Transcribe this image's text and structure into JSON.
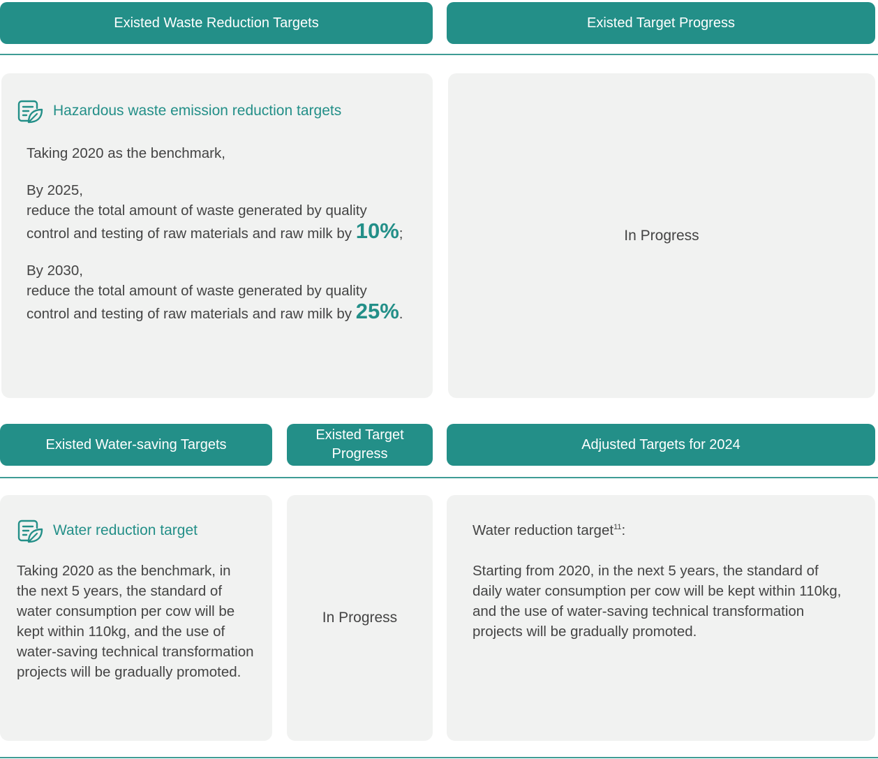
{
  "top": {
    "headers": {
      "left": "Existed Waste Reduction Targets",
      "right": "Existed Target Progress"
    },
    "hazard_card": {
      "title": "Hazardous waste emission reduction targets",
      "benchmark": "Taking 2020 as the benchmark,",
      "items": [
        {
          "year": "By 2025,",
          "text": "reduce the total amount of waste generated by quality control and testing of raw materials and raw milk by",
          "pct": "10%",
          "end": ";"
        },
        {
          "year": "By 2030,",
          "text": "reduce the total amount of waste generated by quality control and testing of raw materials and raw milk by",
          "pct": "25%",
          "end": "."
        }
      ]
    },
    "progress": "In Progress"
  },
  "bottom": {
    "headers": {
      "left": "Existed Water-saving Targets",
      "middle": "Existed Target Progress",
      "right": "Adjusted Targets for 2024"
    },
    "water_card": {
      "title": "Water reduction target",
      "text": "Taking 2020 as the benchmark, in the next 5 years, the standard of water consumption per cow will be kept within 110kg, and the use of water-saving technical transformation projects will be gradually promoted."
    },
    "progress": "In Progress",
    "adjusted": {
      "title": "Water reduction target",
      "footnote": "11",
      "suffix": ":",
      "text": "Starting from 2020, in the next 5 years, the standard of daily water consumption per cow will be kept within 110kg, and the use of water-saving technical transformation projects will be gradually promoted."
    }
  },
  "colors": {
    "accent": "#238f88",
    "card_bg": "#f1f2f1",
    "text": "#444444"
  }
}
